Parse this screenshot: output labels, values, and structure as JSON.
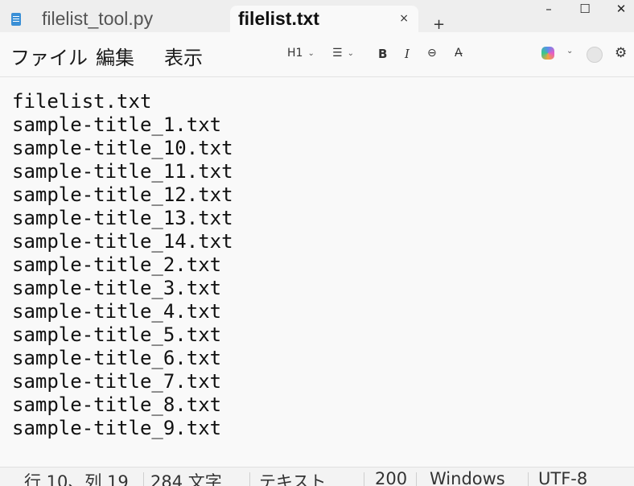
{
  "tabs": [
    {
      "label": "filelist_tool.py",
      "active": false
    },
    {
      "label": "filelist.txt",
      "active": true
    }
  ],
  "tab_close": "×",
  "new_tab": "+",
  "window_controls": {
    "minimize": "–",
    "maximize": "☐",
    "close": "✕"
  },
  "menu": [
    "ファイル",
    "編集",
    "表示"
  ],
  "toolbar": {
    "heading": "H1",
    "list": "☰",
    "bold": "B",
    "italic": "I",
    "link": "⊖",
    "spellcheck": "A̶"
  },
  "editor": {
    "lines": [
      "filelist.txt",
      "sample-title_1.txt",
      "sample-title_10.txt",
      "sample-title_11.txt",
      "sample-title_12.txt",
      "sample-title_13.txt",
      "sample-title_14.txt",
      "sample-title_2.txt",
      "sample-title_3.txt",
      "sample-title_4.txt",
      "sample-title_5.txt",
      "sample-title_6.txt",
      "sample-title_7.txt",
      "sample-title_8.txt",
      "sample-title_9.txt"
    ]
  },
  "status": {
    "position": "行 10、列 19",
    "chars": "284 文字",
    "format": "テキスト",
    "zoom": "200",
    "line_ending": "Windows",
    "encoding": "UTF-8"
  },
  "icons": {
    "tab_file": "notepad-file-icon",
    "copilot": "copilot-icon",
    "account": "account-icon",
    "settings": "gear-icon"
  }
}
